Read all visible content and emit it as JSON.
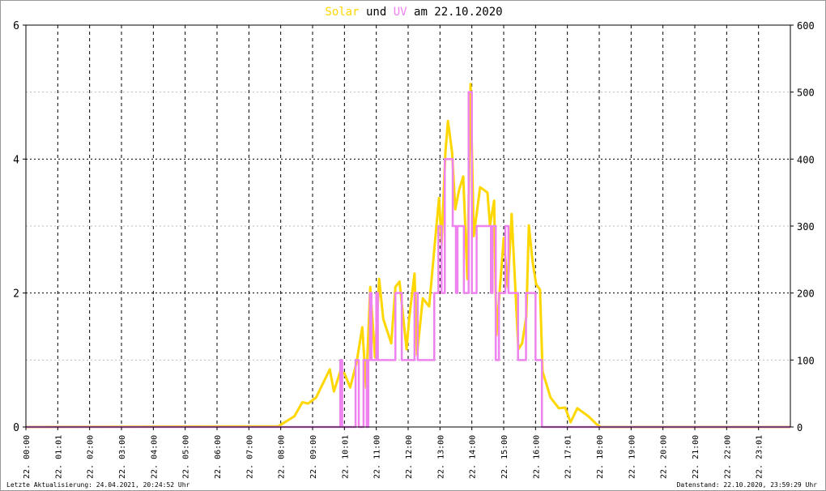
{
  "chart_data": {
    "type": "line",
    "title": {
      "part1": "Solar",
      "part2": "und",
      "part3": "UV",
      "part4": "am 22.10.2020"
    },
    "colors": {
      "solar": "#ffd700",
      "uv": "#ee82ee"
    },
    "xlabel": "",
    "x_range_hours": [
      0,
      24
    ],
    "x_tick_labels": [
      "22. 00:00",
      "22. 01:01",
      "22. 02:00",
      "22. 03:00",
      "22. 04:00",
      "22. 05:00",
      "22. 06:00",
      "22. 07:00",
      "22. 08:00",
      "22. 09:00",
      "22. 10:01",
      "22. 11:00",
      "22. 12:00",
      "22. 13:00",
      "22. 14:00",
      "22. 15:00",
      "22. 16:00",
      "22. 17:01",
      "22. 18:00",
      "22. 19:00",
      "22. 20:00",
      "22. 21:00",
      "22. 22:00",
      "22. 23:01"
    ],
    "y_left": {
      "label": "UV",
      "ylim": [
        0,
        6
      ],
      "ticks": [
        "0",
        "2",
        "4",
        "6"
      ]
    },
    "y_right": {
      "label": "Solar",
      "ylim": [
        0,
        600
      ],
      "ticks": [
        "0",
        "100",
        "200",
        "300",
        "400",
        "500",
        "600"
      ]
    },
    "grid": true,
    "series": [
      {
        "name": "Solar",
        "axis": "right",
        "points": [
          [
            0,
            0
          ],
          [
            7.92,
            1
          ],
          [
            8.43,
            16
          ],
          [
            8.68,
            37
          ],
          [
            8.86,
            35
          ],
          [
            9.11,
            44
          ],
          [
            9.54,
            86
          ],
          [
            9.67,
            53
          ],
          [
            9.87,
            83
          ],
          [
            10.0,
            80
          ],
          [
            10.18,
            59
          ],
          [
            10.38,
            96
          ],
          [
            10.56,
            149
          ],
          [
            10.68,
            59
          ],
          [
            10.81,
            209
          ],
          [
            10.96,
            104
          ],
          [
            11.09,
            221
          ],
          [
            11.22,
            161
          ],
          [
            11.47,
            125
          ],
          [
            11.6,
            209
          ],
          [
            11.73,
            217
          ],
          [
            11.95,
            116
          ],
          [
            12.03,
            161
          ],
          [
            12.2,
            229
          ],
          [
            12.28,
            108
          ],
          [
            12.46,
            192
          ],
          [
            12.66,
            180
          ],
          [
            12.79,
            249
          ],
          [
            12.97,
            342
          ],
          [
            13.05,
            273
          ],
          [
            13.17,
            410
          ],
          [
            13.25,
            457
          ],
          [
            13.38,
            410
          ],
          [
            13.48,
            325
          ],
          [
            13.6,
            354
          ],
          [
            13.73,
            374
          ],
          [
            13.86,
            221
          ],
          [
            13.96,
            512
          ],
          [
            14.06,
            285
          ],
          [
            14.26,
            358
          ],
          [
            14.49,
            350
          ],
          [
            14.57,
            301
          ],
          [
            14.7,
            338
          ],
          [
            14.77,
            137
          ],
          [
            15.0,
            282
          ],
          [
            15.13,
            209
          ],
          [
            15.25,
            318
          ],
          [
            15.46,
            116
          ],
          [
            15.58,
            125
          ],
          [
            15.71,
            165
          ],
          [
            15.79,
            301
          ],
          [
            15.91,
            246
          ],
          [
            16.02,
            213
          ],
          [
            16.14,
            205
          ],
          [
            16.22,
            83
          ],
          [
            16.47,
            44
          ],
          [
            16.73,
            28
          ],
          [
            16.93,
            29
          ],
          [
            17.1,
            7
          ],
          [
            17.31,
            28
          ],
          [
            17.66,
            16
          ],
          [
            17.92,
            4
          ],
          [
            18.05,
            0
          ],
          [
            24,
            0
          ]
        ]
      },
      {
        "name": "UV",
        "axis": "left",
        "step": true,
        "points": [
          [
            0,
            0
          ],
          [
            9.87,
            1
          ],
          [
            9.93,
            0
          ],
          [
            10.35,
            1
          ],
          [
            10.45,
            0
          ],
          [
            10.6,
            1
          ],
          [
            10.7,
            0
          ],
          [
            10.75,
            1
          ],
          [
            10.8,
            2
          ],
          [
            10.85,
            1
          ],
          [
            11.0,
            2
          ],
          [
            11.05,
            1
          ],
          [
            11.6,
            2
          ],
          [
            11.8,
            1
          ],
          [
            12.2,
            2
          ],
          [
            12.3,
            1
          ],
          [
            12.82,
            2
          ],
          [
            12.95,
            3
          ],
          [
            13.05,
            2
          ],
          [
            13.15,
            4
          ],
          [
            13.4,
            3
          ],
          [
            13.5,
            2
          ],
          [
            13.55,
            3
          ],
          [
            13.75,
            2
          ],
          [
            13.9,
            5
          ],
          [
            14.0,
            2
          ],
          [
            14.15,
            3
          ],
          [
            14.6,
            2
          ],
          [
            14.65,
            3
          ],
          [
            14.75,
            1
          ],
          [
            14.85,
            2
          ],
          [
            15.05,
            3
          ],
          [
            15.15,
            2
          ],
          [
            15.45,
            1
          ],
          [
            15.7,
            2
          ],
          [
            16.0,
            1
          ],
          [
            16.2,
            0
          ],
          [
            24,
            0
          ]
        ]
      }
    ]
  },
  "footer": {
    "left": "Letzte Aktualisierung: 24.04.2021, 20:24:52 Uhr",
    "right": "Datenstand: 22.10.2020, 23:59:29 Uhr"
  }
}
